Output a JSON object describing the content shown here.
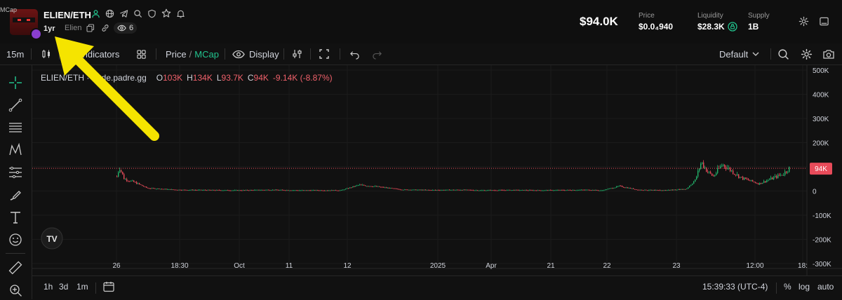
{
  "header": {
    "mcap_tag": "MCap",
    "pair": "ELIEN/ETH",
    "age": "1yr",
    "token_name": "Elien",
    "watchers": "6",
    "price_big": "$94.0K",
    "stats": [
      {
        "label": "Price",
        "value": "$0.0₄940"
      },
      {
        "label": "Liquidity",
        "value": "$28.3K"
      },
      {
        "label": "Supply",
        "value": "1B"
      }
    ]
  },
  "toolbar": {
    "interval": "15m",
    "indicators": "Indicators",
    "price_label": "Price",
    "slash": "/",
    "mcap_label": "MCap",
    "display_label": "Display",
    "preset": "Default"
  },
  "legend": {
    "symbol": "ELIEN/ETH · trade.padre.gg",
    "o_label": "O",
    "o_value": "103K",
    "h_label": "H",
    "h_value": "134K",
    "l_label": "L",
    "l_value": "93.7K",
    "c_label": "C",
    "c_value": "94K",
    "change": "-9.14K (-8.87%)"
  },
  "chart_data": {
    "type": "candlestick",
    "y_ticks": [
      "500K",
      "400K",
      "300K",
      "200K",
      "100K",
      "0",
      "-100K",
      "-200K",
      "-300K"
    ],
    "x_ticks": [
      "26",
      "18:30",
      "Oct",
      "11",
      "12",
      "2025",
      "Apr",
      "21",
      "22",
      "23",
      "12:00",
      "18:"
    ],
    "last_price_label": "94K",
    "last_price": 94,
    "ylim": [
      -300,
      500
    ],
    "up_color": "#22b36b",
    "down_color": "#e84b5a",
    "series_profile": [
      [
        0.0,
        60
      ],
      [
        0.004,
        100
      ],
      [
        0.012,
        50
      ],
      [
        0.03,
        35
      ],
      [
        0.05,
        12
      ],
      [
        0.1,
        5
      ],
      [
        0.2,
        3
      ],
      [
        0.25,
        5
      ],
      [
        0.3,
        3
      ],
      [
        0.37,
        3
      ],
      [
        0.4,
        25
      ],
      [
        0.43,
        18
      ],
      [
        0.47,
        6
      ],
      [
        0.52,
        4
      ],
      [
        0.57,
        5
      ],
      [
        0.6,
        3
      ],
      [
        0.65,
        4
      ],
      [
        0.7,
        3
      ],
      [
        0.78,
        5
      ],
      [
        0.8,
        2
      ],
      [
        0.83,
        20
      ],
      [
        0.86,
        5
      ],
      [
        0.9,
        3
      ],
      [
        0.94,
        8
      ],
      [
        0.955,
        45
      ],
      [
        0.965,
        120
      ],
      [
        0.975,
        80
      ],
      [
        0.985,
        60
      ],
      [
        0.995,
        95
      ],
      [
        1.0,
        110
      ],
      [
        1.03,
        55
      ],
      [
        1.06,
        30
      ],
      [
        1.1,
        70
      ],
      [
        1.11,
        94
      ]
    ]
  },
  "bottombar": {
    "ranges": [
      "1h",
      "3d",
      "1m"
    ],
    "time": "15:39:33 (UTC-4)",
    "percent": "%",
    "log": "log",
    "auto": "auto"
  },
  "colors": {
    "accent": "#22c38e",
    "up": "#22b36b",
    "down": "#e84b5a",
    "annotation": "#f5e400"
  }
}
